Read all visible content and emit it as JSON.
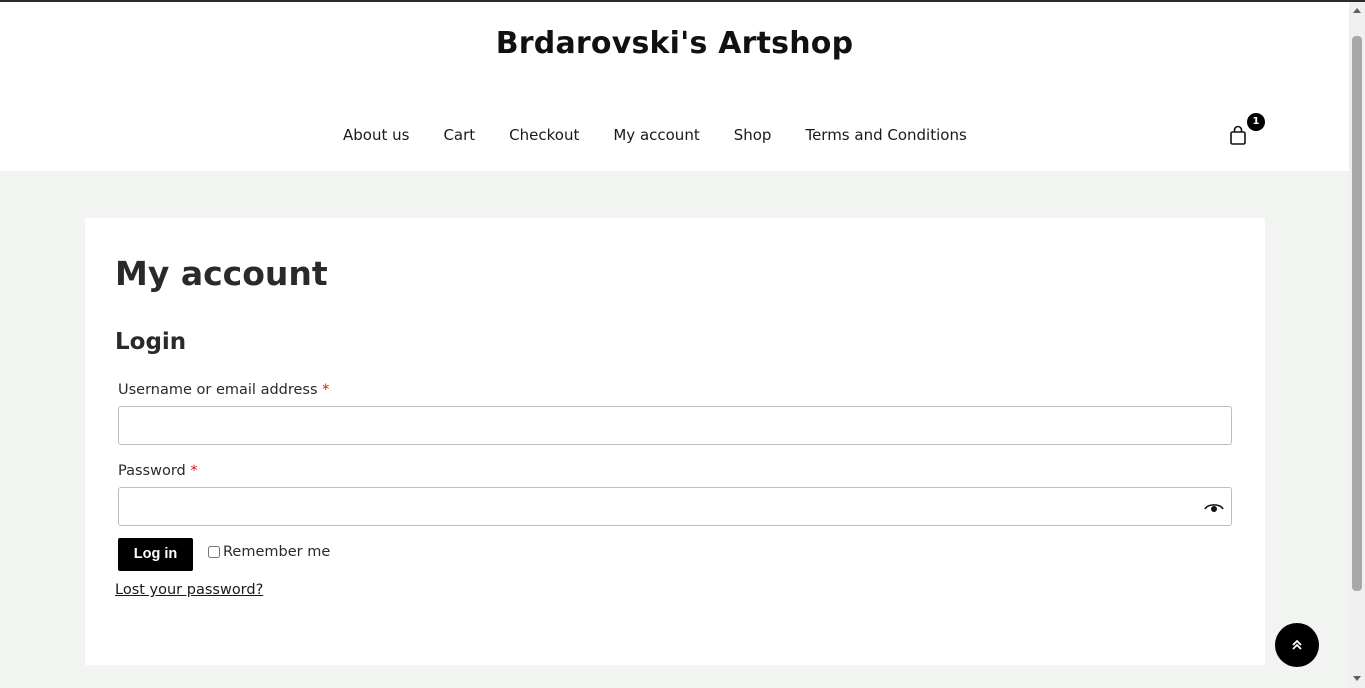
{
  "site": {
    "title": "Brdarovski's Artshop"
  },
  "nav": {
    "items": [
      {
        "label": "About us"
      },
      {
        "label": "Cart"
      },
      {
        "label": "Checkout"
      },
      {
        "label": "My account"
      },
      {
        "label": "Shop"
      },
      {
        "label": "Terms and Conditions"
      }
    ]
  },
  "cart": {
    "count": "1",
    "icon": "shopping-bag-icon"
  },
  "page": {
    "title": "My account"
  },
  "login": {
    "title": "Login",
    "username_label": "Username or email address",
    "password_label": "Password",
    "required_mark": "*",
    "username_value": "",
    "password_value": "",
    "submit_label": "Log in",
    "remember_label": "Remember me",
    "remember_checked": false,
    "lost_password": "Lost your password?"
  },
  "icons": {
    "eye": "eye-icon",
    "scroll_top": "double-chevron-up-icon"
  },
  "colors": {
    "accent": "#000000",
    "required": "#dd1111",
    "background": "#f2f4f2"
  }
}
